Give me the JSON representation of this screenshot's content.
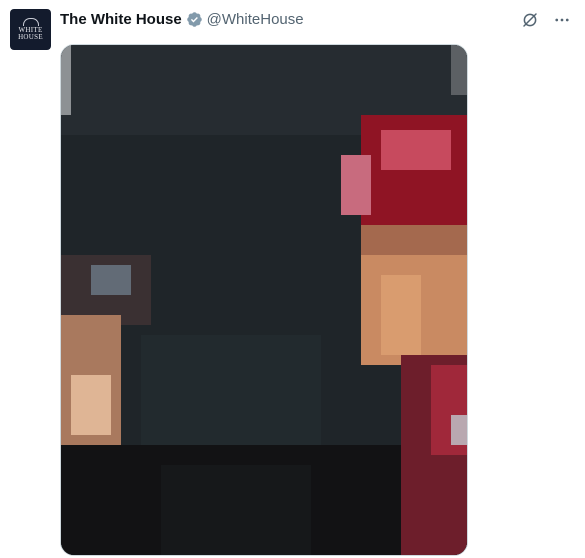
{
  "post": {
    "author": {
      "name": "The White House",
      "handle": "@WhiteHouse",
      "verified": true,
      "verified_badge_color": "#829aab",
      "avatar": {
        "line1": "WHITE",
        "line2": "HOUSE",
        "background": "#131b2d"
      }
    },
    "actions": [
      "grok-icon",
      "more-icon"
    ],
    "media": {
      "type": "pixelated-photo"
    }
  }
}
